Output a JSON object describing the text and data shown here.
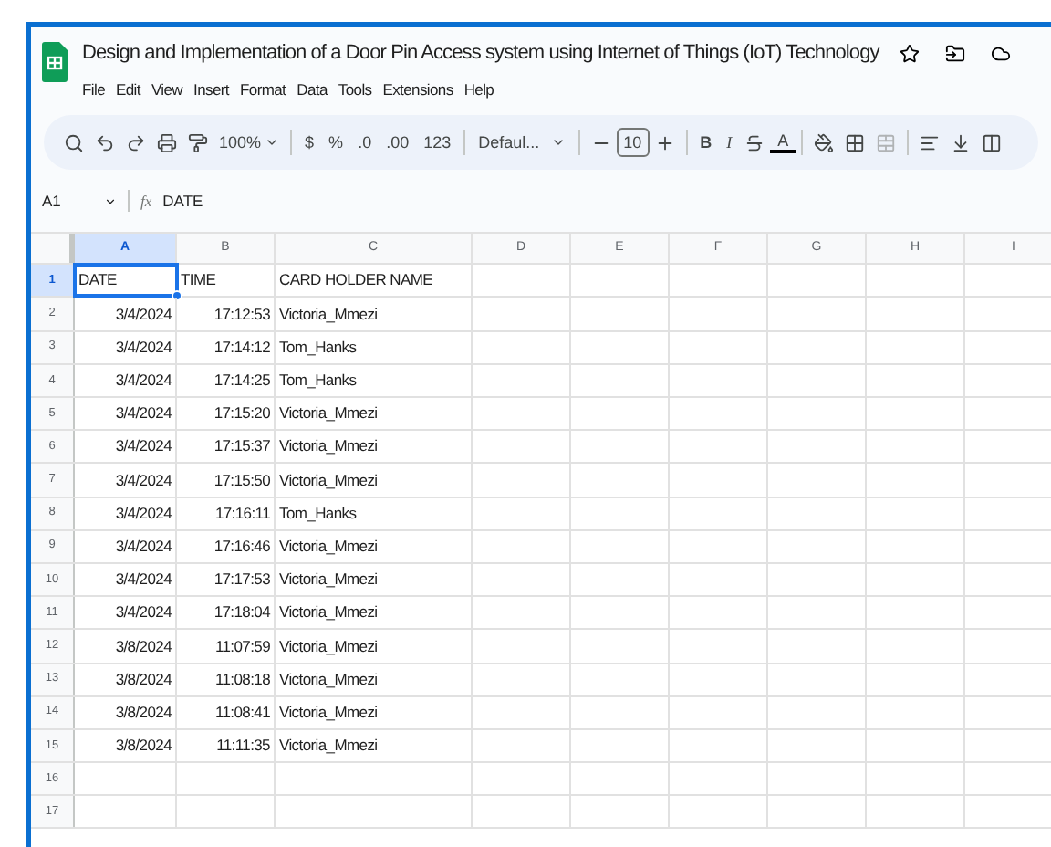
{
  "document": {
    "title": "Design and Implementation of a Door Pin Access system using Internet of Things (IoT) Technology"
  },
  "menu": [
    "File",
    "Edit",
    "View",
    "Insert",
    "Format",
    "Data",
    "Tools",
    "Extensions",
    "Help"
  ],
  "toolbar": {
    "zoom": "100%",
    "currency": "$",
    "percent": "%",
    "decrease_decimal": ".0",
    "increase_decimal": ".00",
    "number_format": "123",
    "font": "Defaul...",
    "font_size": "10",
    "bold": "B",
    "italic": "I",
    "text_color": "A"
  },
  "formula_bar": {
    "cell_ref": "A1",
    "fx": "fx",
    "value": "DATE"
  },
  "columns": [
    {
      "label": "A",
      "selected": true
    },
    {
      "label": "B",
      "selected": false
    },
    {
      "label": "C",
      "selected": false
    },
    {
      "label": "D",
      "selected": false
    },
    {
      "label": "E",
      "selected": false
    },
    {
      "label": "F",
      "selected": false
    },
    {
      "label": "G",
      "selected": false
    },
    {
      "label": "H",
      "selected": false
    },
    {
      "label": "I",
      "selected": false
    }
  ],
  "rows": [
    {
      "number": "1",
      "selected": true,
      "cells": [
        "DATE",
        "TIME",
        "CARD HOLDER NAME"
      ]
    },
    {
      "number": "2",
      "selected": false,
      "cells": [
        "3/4/2024",
        "17:12:53",
        "Victoria_Mmezi"
      ]
    },
    {
      "number": "3",
      "selected": false,
      "cells": [
        "3/4/2024",
        "17:14:12",
        "Tom_Hanks"
      ]
    },
    {
      "number": "4",
      "selected": false,
      "cells": [
        "3/4/2024",
        "17:14:25",
        "Tom_Hanks"
      ]
    },
    {
      "number": "5",
      "selected": false,
      "cells": [
        "3/4/2024",
        "17:15:20",
        "Victoria_Mmezi"
      ]
    },
    {
      "number": "6",
      "selected": false,
      "cells": [
        "3/4/2024",
        "17:15:37",
        "Victoria_Mmezi"
      ]
    },
    {
      "number": "7",
      "selected": false,
      "cells": [
        "3/4/2024",
        "17:15:50",
        "Victoria_Mmezi"
      ]
    },
    {
      "number": "8",
      "selected": false,
      "cells": [
        "3/4/2024",
        "17:16:11",
        "Tom_Hanks"
      ]
    },
    {
      "number": "9",
      "selected": false,
      "cells": [
        "3/4/2024",
        "17:16:46",
        "Victoria_Mmezi"
      ]
    },
    {
      "number": "10",
      "selected": false,
      "cells": [
        "3/4/2024",
        "17:17:53",
        "Victoria_Mmezi"
      ]
    },
    {
      "number": "11",
      "selected": false,
      "cells": [
        "3/4/2024",
        "17:18:04",
        "Victoria_Mmezi"
      ]
    },
    {
      "number": "12",
      "selected": false,
      "cells": [
        "3/8/2024",
        "11:07:59",
        "Victoria_Mmezi"
      ]
    },
    {
      "number": "13",
      "selected": false,
      "cells": [
        "3/8/2024",
        "11:08:18",
        "Victoria_Mmezi"
      ]
    },
    {
      "number": "14",
      "selected": false,
      "cells": [
        "3/8/2024",
        "11:08:41",
        "Victoria_Mmezi"
      ]
    },
    {
      "number": "15",
      "selected": false,
      "cells": [
        "3/8/2024",
        "11:11:35",
        "Victoria_Mmezi"
      ]
    },
    {
      "number": "16",
      "selected": false,
      "cells": []
    },
    {
      "number": "17",
      "selected": false,
      "cells": []
    }
  ]
}
